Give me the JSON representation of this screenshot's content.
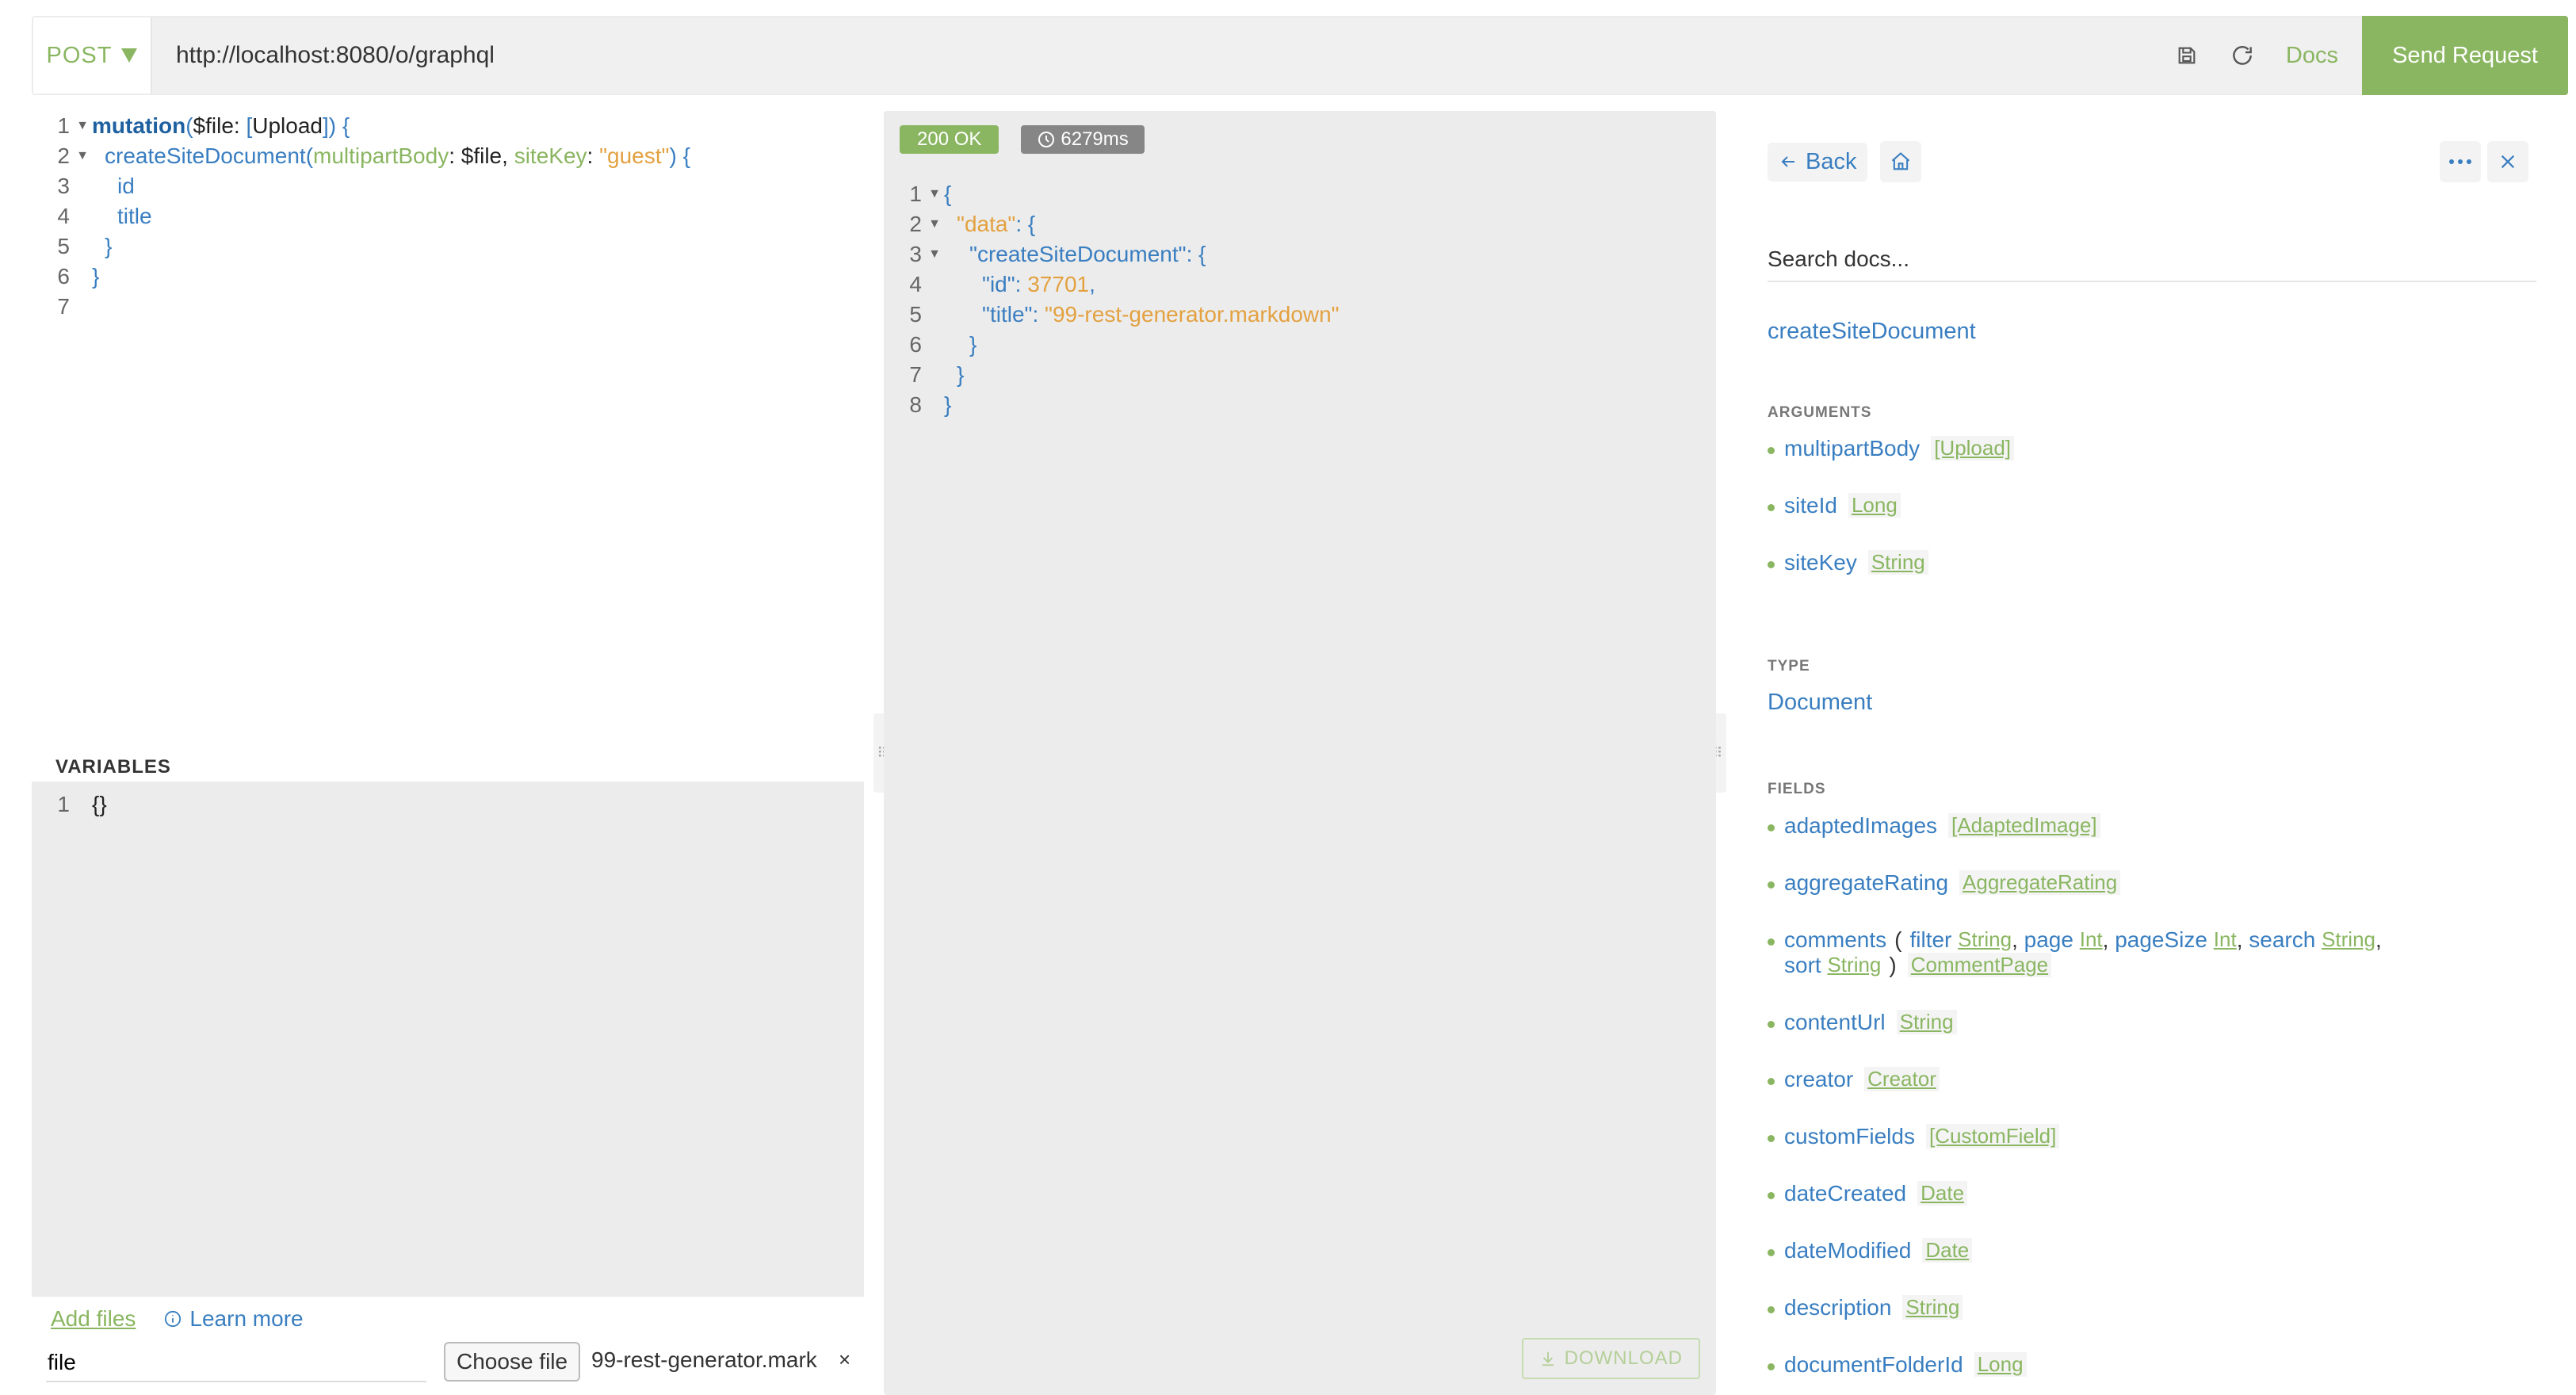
{
  "topbar": {
    "method": "POST",
    "url": "http://localhost:8080/o/graphql",
    "docs_label": "Docs",
    "send_label": "Send Request"
  },
  "query_lines": [
    {
      "n": "1",
      "fold": true
    },
    {
      "n": "2",
      "fold": true
    },
    {
      "n": "3",
      "fold": false
    },
    {
      "n": "4",
      "fold": false
    },
    {
      "n": "5",
      "fold": false
    },
    {
      "n": "6",
      "fold": false
    },
    {
      "n": "7",
      "fold": false
    }
  ],
  "query": {
    "l1_kw": "mutation",
    "l1_paren_open": "(",
    "l1_var": "$file",
    "l1_colon": ": ",
    "l1_bracket_open": "[",
    "l1_type": "Upload",
    "l1_bracket_close": "]",
    "l1_end": ") {",
    "l2_fn": "createSiteDocument",
    "l2_paren": "(",
    "l2_arg1": "multipartBody",
    "l2_colon1": ": ",
    "l2_var": "$file",
    "l2_comma": ", ",
    "l2_arg2": "siteKey",
    "l2_colon2": ": ",
    "l2_str": "\"guest\"",
    "l2_end": ") {",
    "l3_field": "id",
    "l4_field": "title",
    "l5": "}",
    "l6": "}"
  },
  "variables": {
    "title": "VARIABLES",
    "line_no": "1",
    "value": "{}"
  },
  "files": {
    "add_files": "Add files",
    "learn_more": "Learn more",
    "name_value": "file",
    "choose_label": "Choose file",
    "chosen_name": "99-rest-generator.mark",
    "remove": "×"
  },
  "response": {
    "status": "200 OK",
    "time": "6279ms",
    "download": "DOWNLOAD",
    "lines": [
      {
        "n": "1",
        "fold": true
      },
      {
        "n": "2",
        "fold": true
      },
      {
        "n": "3",
        "fold": true
      },
      {
        "n": "4",
        "fold": false
      },
      {
        "n": "5",
        "fold": false
      },
      {
        "n": "6",
        "fold": false
      },
      {
        "n": "7",
        "fold": false
      },
      {
        "n": "8",
        "fold": false
      }
    ],
    "l1": "{",
    "l2_key": "\"data\"",
    "l2_rest": ": {",
    "l3_key": "\"createSiteDocument\"",
    "l3_rest": ": {",
    "l4_key": "\"id\"",
    "l4_colon": ": ",
    "l4_val": "37701",
    "l4_comma": ",",
    "l5_key": "\"title\"",
    "l5_colon": ": ",
    "l5_val": "\"99-rest-generator.markdown\"",
    "l6": "}",
    "l7": "}",
    "l8": "}"
  },
  "docs": {
    "back": "Back",
    "search_placeholder": "Search docs...",
    "title": "createSiteDocument",
    "arguments_heading": "ARGUMENTS",
    "arguments": [
      {
        "name": "multipartBody",
        "type": "[Upload]"
      },
      {
        "name": "siteId",
        "type": "Long"
      },
      {
        "name": "siteKey",
        "type": "String"
      }
    ],
    "type_heading": "TYPE",
    "type": "Document",
    "fields_heading": "FIELDS",
    "fields": [
      {
        "name": "adaptedImages",
        "type": "[AdaptedImage]"
      },
      {
        "name": "aggregateRating",
        "type": "AggregateRating"
      },
      {
        "name": "contentUrl",
        "type": "String"
      },
      {
        "name": "creator",
        "type": "Creator"
      },
      {
        "name": "customFields",
        "type": "[CustomField]"
      },
      {
        "name": "dateCreated",
        "type": "Date"
      },
      {
        "name": "dateModified",
        "type": "Date"
      },
      {
        "name": "description",
        "type": "String"
      },
      {
        "name": "documentFolderId",
        "type": "Long"
      }
    ],
    "comments": {
      "name": "comments",
      "open": "(",
      "args": [
        {
          "name": "filter",
          "type": "String"
        },
        {
          "name": "page",
          "type": "Int"
        },
        {
          "name": "pageSize",
          "type": "Int"
        },
        {
          "name": "search",
          "type": "String"
        },
        {
          "name": "sort",
          "type": "String"
        }
      ],
      "close": ")",
      "type": "CommentPage"
    }
  },
  "colors": {
    "accent": "#8ab661",
    "link": "#397ec0",
    "string": "#e3a140"
  }
}
